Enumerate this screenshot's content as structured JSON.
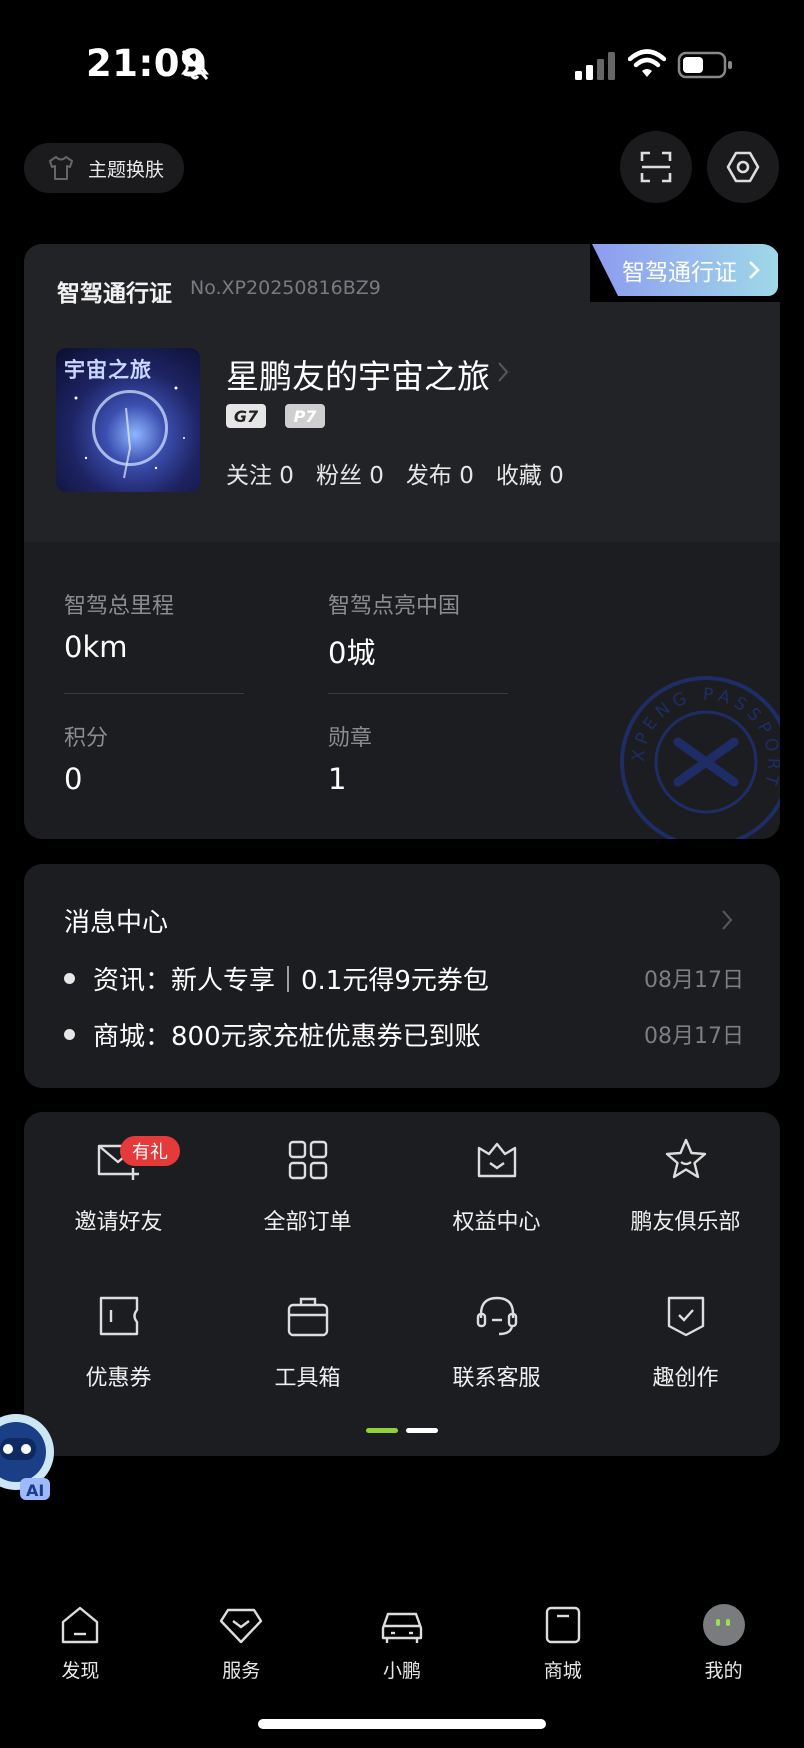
{
  "status_bar": {
    "time": "21:09"
  },
  "header": {
    "theme_label": "主题换肤"
  },
  "passport": {
    "title": "智驾通行证",
    "number": "No.XP20250816BZ9",
    "tab_label": "智驾通行证",
    "avatar_text": "宇宙之旅",
    "nickname": "星鹏友的宇宙之旅",
    "tags": [
      "G7",
      "P7"
    ],
    "stats": {
      "follow": "关注 0",
      "fans": "粉丝 0",
      "posts": "发布 0",
      "favorites": "收藏 0"
    },
    "metrics": {
      "mileage_label": "智驾总里程",
      "mileage_value": "0km",
      "cities_label": "智驾点亮中国",
      "cities_value": "0城",
      "points_label": "积分",
      "points_value": "0",
      "medals_label": "勋章",
      "medals_value": "1"
    },
    "seal_text": "XPENG PASSPORT"
  },
  "messages": {
    "title": "消息中心",
    "items": [
      {
        "text": "资讯：新人专享｜0.1元得9元券包",
        "date": "08月17日"
      },
      {
        "text": "商城：800元家充桩优惠券已到账",
        "date": "08月17日"
      }
    ]
  },
  "features": {
    "badge": "有礼",
    "items": [
      {
        "label": "邀请好友",
        "icon": "invite-mail-icon"
      },
      {
        "label": "全部订单",
        "icon": "grid-icon"
      },
      {
        "label": "权益中心",
        "icon": "crown-icon"
      },
      {
        "label": "鹏友俱乐部",
        "icon": "star-icon"
      },
      {
        "label": "优惠券",
        "icon": "coupon-icon"
      },
      {
        "label": "工具箱",
        "icon": "toolbox-icon"
      },
      {
        "label": "联系客服",
        "icon": "headset-icon"
      },
      {
        "label": "趣创作",
        "icon": "shield-check-icon"
      }
    ],
    "page_count": 2,
    "active_page": 1
  },
  "bottom_nav": {
    "items": [
      {
        "label": "发现",
        "icon": "home-icon"
      },
      {
        "label": "服务",
        "icon": "diamond-icon"
      },
      {
        "label": "小鹏",
        "icon": "car-icon"
      },
      {
        "label": "商城",
        "icon": "bag-icon"
      },
      {
        "label": "我的",
        "icon": "avatar"
      }
    ],
    "active": "我的"
  },
  "colors": {
    "background": "#000000",
    "card": "#1c1d20",
    "accent_green": "#8fd13a",
    "badge_red": "#e53a3a",
    "tab_gradient_start": "#8d9bf0",
    "tab_gradient_end": "#9fd8e8"
  }
}
